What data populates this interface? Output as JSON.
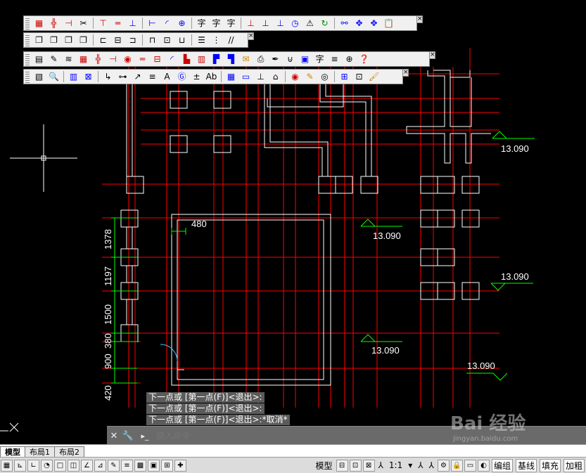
{
  "drawing": {
    "elevations": [
      "13.090",
      "13.090",
      "13.090",
      "13.090",
      "13.090"
    ],
    "dim_480": "480",
    "vertical_dims": [
      "1378",
      "1197",
      "1500",
      "380",
      "900",
      "420"
    ]
  },
  "command_history": [
    "下一点或 [第一点(F)]<退出>:",
    "下一点或 [第一点(F)]<退出>:",
    "下一点或 [第一点(F)]<退出>:*取消*"
  ],
  "command_line": {
    "close_label": "✕",
    "wrench_label": "🔧",
    "prompt_label": "▸_",
    "placeholder": "键入命令"
  },
  "tabs": [
    {
      "label": "模型"
    },
    {
      "label": "布局1"
    },
    {
      "label": "布局2"
    }
  ],
  "status_bar": {
    "model_label": "模型",
    "scale_label": "1:1",
    "right_buttons": [
      "编组",
      "基线",
      "填充",
      "加粗"
    ]
  },
  "watermark": {
    "brand": "Bai 经验",
    "url": "jingyan.baidu.com"
  },
  "colors": {
    "background": "#000000",
    "axis_red": "#ff0000",
    "wall_white": "#ffffff",
    "dim_green": "#00ff00"
  }
}
